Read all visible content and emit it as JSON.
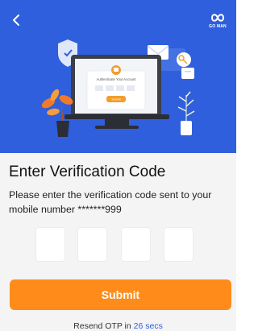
{
  "header": {
    "back_icon": "chevron-left-icon",
    "brand_logo_text": "GO MAN",
    "brand_logo_icon": "infinity-loop-icon"
  },
  "illustration": {
    "card_title": "Authenticate Your Account",
    "card_button": "Submit"
  },
  "verification": {
    "title": "Enter Verification Code",
    "description": "Please enter the verification code sent to your mobile number *******999",
    "otp_boxes": [
      "",
      "",
      "",
      ""
    ],
    "submit_label": "Submit",
    "resend_prefix": "Resend OTP in ",
    "resend_timer": "26 secs"
  },
  "colors": {
    "header_bg": "#2f5fdc",
    "accent_orange": "#ff8c1a",
    "sheet_bg": "#f4f4f5",
    "link_blue": "#2f5fdc"
  }
}
